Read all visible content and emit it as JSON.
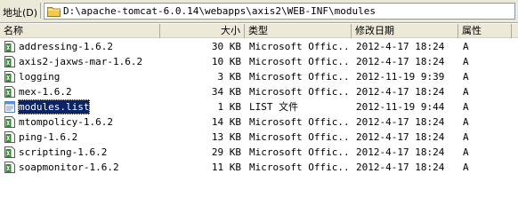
{
  "address_bar": {
    "label": "地址(D)",
    "path": "D:\\apache-tomcat-6.0.14\\webapps\\axis2\\WEB-INF\\modules"
  },
  "columns": {
    "name": "名称",
    "size": "大小",
    "type": "类型",
    "modified": "修改日期",
    "attributes": "属性"
  },
  "files": [
    {
      "name": "addressing-1.6.2",
      "size": "30 KB",
      "type": "Microsoft Offic...",
      "modified": "2012-4-17 18:24",
      "attr": "A",
      "icon": "document-icon"
    },
    {
      "name": "axis2-jaxws-mar-1.6.2",
      "size": "10 KB",
      "type": "Microsoft Offic...",
      "modified": "2012-4-17 18:24",
      "attr": "A",
      "icon": "document-icon"
    },
    {
      "name": "logging",
      "size": "3 KB",
      "type": "Microsoft Offic...",
      "modified": "2012-11-19 9:39",
      "attr": "A",
      "icon": "document-icon"
    },
    {
      "name": "mex-1.6.2",
      "size": "34 KB",
      "type": "Microsoft Offic...",
      "modified": "2012-4-17 18:24",
      "attr": "A",
      "icon": "document-icon"
    },
    {
      "name": "modules.list",
      "size": "1 KB",
      "type": "LIST 文件",
      "modified": "2012-11-19 9:44",
      "attr": "A",
      "icon": "list-file-icon",
      "selected": true
    },
    {
      "name": "mtompolicy-1.6.2",
      "size": "14 KB",
      "type": "Microsoft Offic...",
      "modified": "2012-4-17 18:24",
      "attr": "A",
      "icon": "document-icon"
    },
    {
      "name": "ping-1.6.2",
      "size": "13 KB",
      "type": "Microsoft Offic...",
      "modified": "2012-4-17 18:24",
      "attr": "A",
      "icon": "document-icon"
    },
    {
      "name": "scripting-1.6.2",
      "size": "29 KB",
      "type": "Microsoft Offic...",
      "modified": "2012-4-17 18:24",
      "attr": "A",
      "icon": "document-icon"
    },
    {
      "name": "soapmonitor-1.6.2",
      "size": "11 KB",
      "type": "Microsoft Offic...",
      "modified": "2012-4-17 18:24",
      "attr": "A",
      "icon": "document-icon"
    }
  ],
  "colors": {
    "selection": "#0a246a",
    "header_bg": "#ece9d8",
    "icon_green": "#2f8a2f",
    "folder_yellow": "#f2c94c"
  }
}
